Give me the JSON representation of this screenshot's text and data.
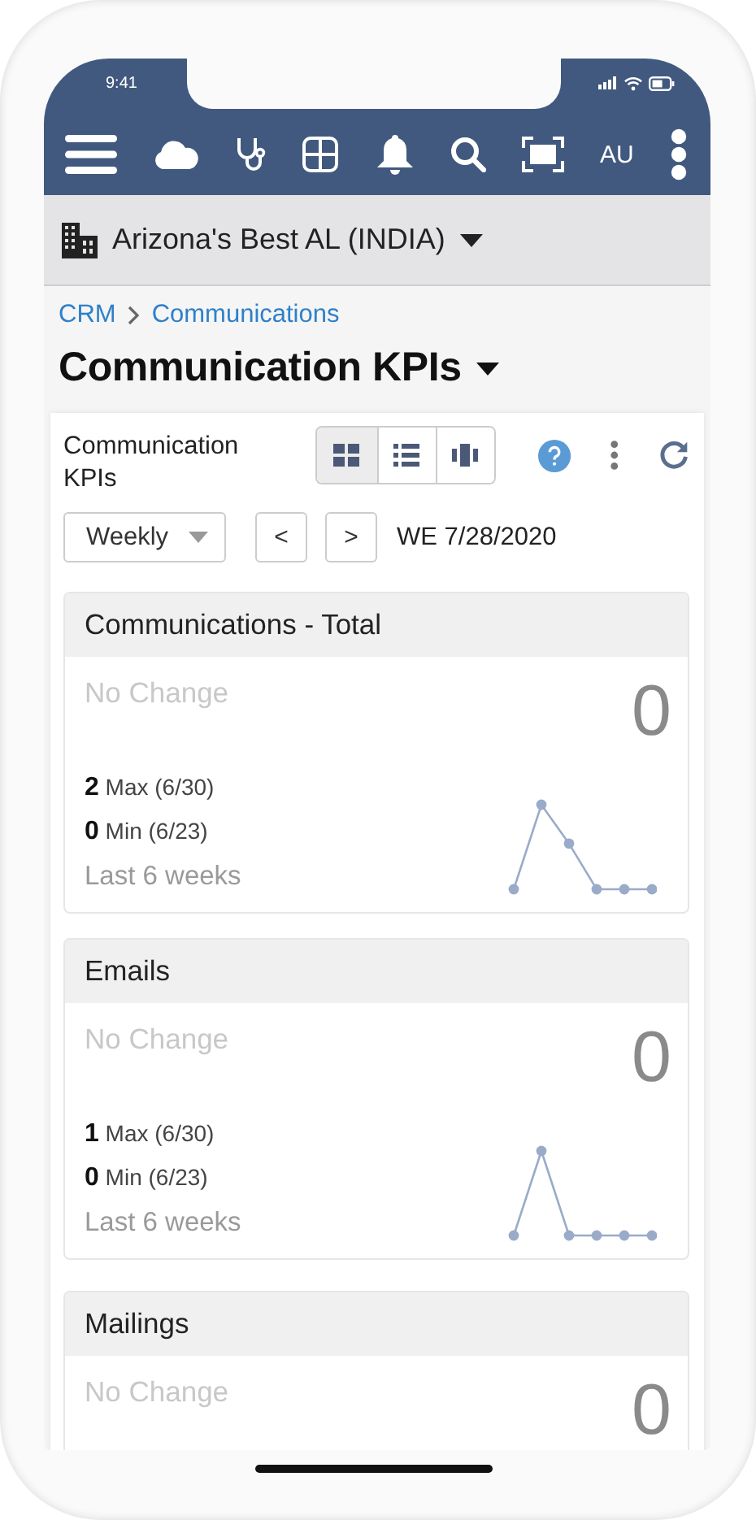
{
  "status_bar": {
    "time": "9:41"
  },
  "toolbar": {
    "user_initials": "AU"
  },
  "location": {
    "name": "Arizona's Best AL (INDIA)"
  },
  "breadcrumb": [
    {
      "label": "CRM"
    },
    {
      "label": "Communications"
    }
  ],
  "page_title": "Communication KPIs",
  "panel": {
    "title": "Communication KPIs",
    "views": [
      {
        "kind": "tiles",
        "selected": true
      },
      {
        "kind": "list",
        "selected": false
      },
      {
        "kind": "columns",
        "selected": false
      }
    ],
    "period": "Weekly",
    "prev": "<",
    "next": ">",
    "week_ending": "WE 7/28/2020"
  },
  "cards": [
    {
      "title": "Communications - Total",
      "change": "No Change",
      "value": "0",
      "max": "2",
      "max_label": "Max (6/30)",
      "min": "0",
      "min_label": "Min (6/23)",
      "range": "Last 6 weeks"
    },
    {
      "title": "Emails",
      "change": "No Change",
      "value": "0",
      "max": "1",
      "max_label": "Max (6/30)",
      "min": "0",
      "min_label": "Min (6/23)",
      "range": "Last 6 weeks"
    },
    {
      "title": "Mailings",
      "change": "No Change",
      "value": "0"
    }
  ]
}
